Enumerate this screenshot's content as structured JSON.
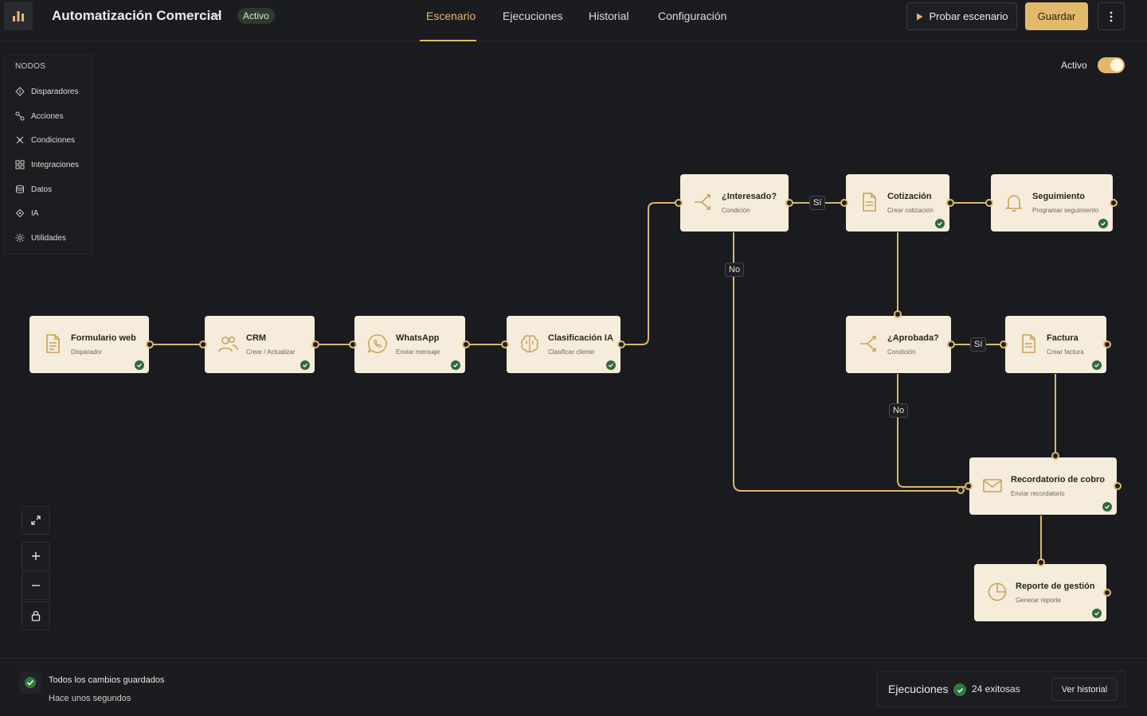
{
  "header": {
    "title": "Automatización Comercial",
    "status_badge": "Activo",
    "tabs": [
      {
        "label": "Escenario",
        "active": true
      },
      {
        "label": "Ejecuciones",
        "active": false
      },
      {
        "label": "Historial",
        "active": false
      },
      {
        "label": "Configuración",
        "active": false
      }
    ],
    "test_button": "Probar escenario",
    "save_button": "Guardar"
  },
  "sidebar": {
    "title": "NODOS",
    "items": [
      {
        "label": "Disparadores",
        "icon": "trigger-icon"
      },
      {
        "label": "Acciones",
        "icon": "actions-icon"
      },
      {
        "label": "Condiciones",
        "icon": "conditions-icon"
      },
      {
        "label": "Integraciones",
        "icon": "integrations-icon"
      },
      {
        "label": "Datos",
        "icon": "database-icon"
      },
      {
        "label": "IA",
        "icon": "ai-icon"
      },
      {
        "label": "Utilidades",
        "icon": "utilities-icon"
      }
    ]
  },
  "canvas": {
    "toggle_label": "Activo",
    "toggle_on": true,
    "accent_color": "#e2b96a",
    "node_bg": "#f6ecdb",
    "nodes": [
      {
        "id": "form",
        "title": "Formulario web",
        "subtitle": "Disparador",
        "icon": "document-icon",
        "ok": true
      },
      {
        "id": "crm",
        "title": "CRM",
        "subtitle": "Crear / Actualizar",
        "icon": "users-icon",
        "ok": true
      },
      {
        "id": "whatsapp",
        "title": "WhatsApp",
        "subtitle": "Enviar mensaje",
        "icon": "whatsapp-icon",
        "ok": true
      },
      {
        "id": "ia",
        "title": "Clasificación IA",
        "subtitle": "Clasificar cliente",
        "icon": "brain-icon",
        "ok": true
      },
      {
        "id": "interesado",
        "title": "¿Interesado?",
        "subtitle": "Condición",
        "icon": "split-icon",
        "ok": false
      },
      {
        "id": "cotizacion",
        "title": "Cotización",
        "subtitle": "Crear cotización",
        "icon": "document-icon",
        "ok": true
      },
      {
        "id": "seguimiento",
        "title": "Seguimiento",
        "subtitle": "Programar seguimiento",
        "icon": "bell-icon",
        "ok": true
      },
      {
        "id": "aprobada",
        "title": "¿Aprobada?",
        "subtitle": "Condición",
        "icon": "split-icon",
        "ok": false
      },
      {
        "id": "factura",
        "title": "Factura",
        "subtitle": "Crear factura",
        "icon": "document-icon",
        "ok": true
      },
      {
        "id": "recordatorio",
        "title": "Recordatorio de cobro",
        "subtitle": "Enviar recordatorio",
        "icon": "mail-icon",
        "ok": true
      },
      {
        "id": "reporte",
        "title": "Reporte de gestión",
        "subtitle": "Generar reporte",
        "icon": "pie-chart-icon",
        "ok": true
      }
    ],
    "edge_labels": [
      "Sí",
      "No",
      "Sí",
      "No"
    ]
  },
  "footer": {
    "save_status": "Todos los cambios guardados",
    "save_time": "Hace unos segundos",
    "executions_label": "Ejecuciones",
    "executions_count": "24 exitosas",
    "history_button": "Ver historial"
  }
}
